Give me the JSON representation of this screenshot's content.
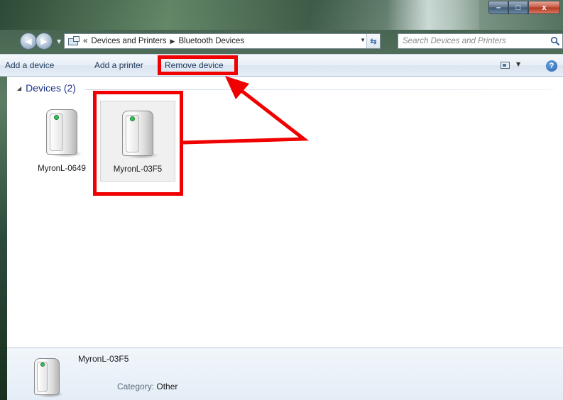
{
  "window": {
    "controls": {
      "minimize": "–",
      "maximize": "□",
      "close": "x"
    }
  },
  "nav": {
    "breadcrumb": [
      "«",
      "Devices and Printers",
      "Bluetooth Devices"
    ],
    "search_placeholder": "Search Devices and Printers"
  },
  "toolbar": {
    "add_device": "Add a device",
    "add_printer": "Add a printer",
    "remove_device": "Remove device"
  },
  "group": {
    "label": "Devices (2)"
  },
  "devices": [
    {
      "name": "MyronL-0649",
      "selected": false
    },
    {
      "name": "MyronL-03F5",
      "selected": true
    }
  ],
  "details": {
    "name": "MyronL-03F5",
    "category_label": "Category:",
    "category_value": "Other"
  },
  "colors": {
    "annotation": "#f00000",
    "group_header": "#1e3287",
    "cmd_text": "#1e395b"
  }
}
